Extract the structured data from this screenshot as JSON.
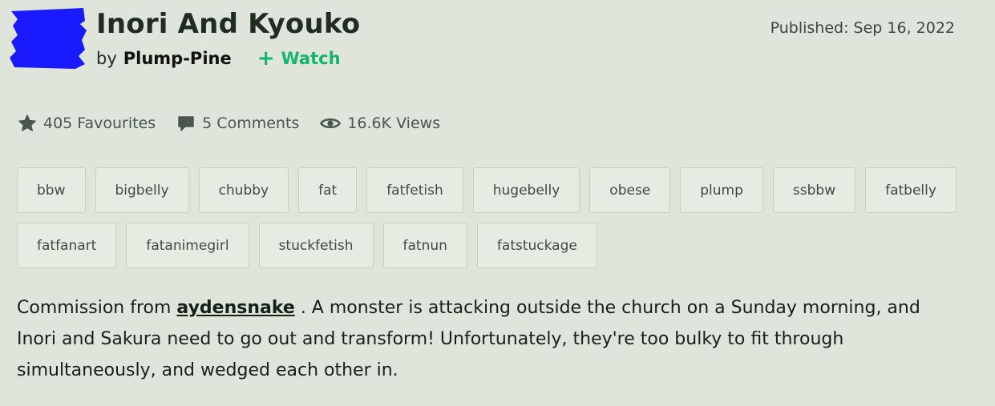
{
  "deviation": {
    "title": "Inori And Kyouko",
    "by_label": "by",
    "author": "Plump-Pine",
    "watch_label": "Watch",
    "published": "Published: Sep 16, 2022"
  },
  "stats": {
    "favourites": "405 Favourites",
    "comments": "5 Comments",
    "views": "16.6K Views"
  },
  "tags": [
    [
      "bbw",
      "bigbelly",
      "chubby",
      "fat",
      "fatfetish",
      "hugebelly",
      "obese",
      "plump",
      "ssbbw",
      "fatbelly"
    ],
    [
      "fatfanart",
      "fatanimegirl",
      "stuckfetish",
      "fatnun",
      "fatstuckage"
    ]
  ],
  "description": {
    "prefix": "Commission from ",
    "link": "aydensnake",
    "suffix": " . A monster is attacking outside the church on a Sunday morning, and Inori and Sakura need to go out and transform! Unfortunately, they're too bulky to fit through simultaneously, and wedged each other in."
  },
  "colors": {
    "background": "#dfe5da",
    "watch_accent": "#13b56b",
    "redaction": "#1a1aff"
  },
  "icons": {
    "avatar": "avatar-redacted",
    "favourites": "star-icon",
    "comments": "comment-icon",
    "views": "eye-icon",
    "watch": "plus-icon"
  }
}
